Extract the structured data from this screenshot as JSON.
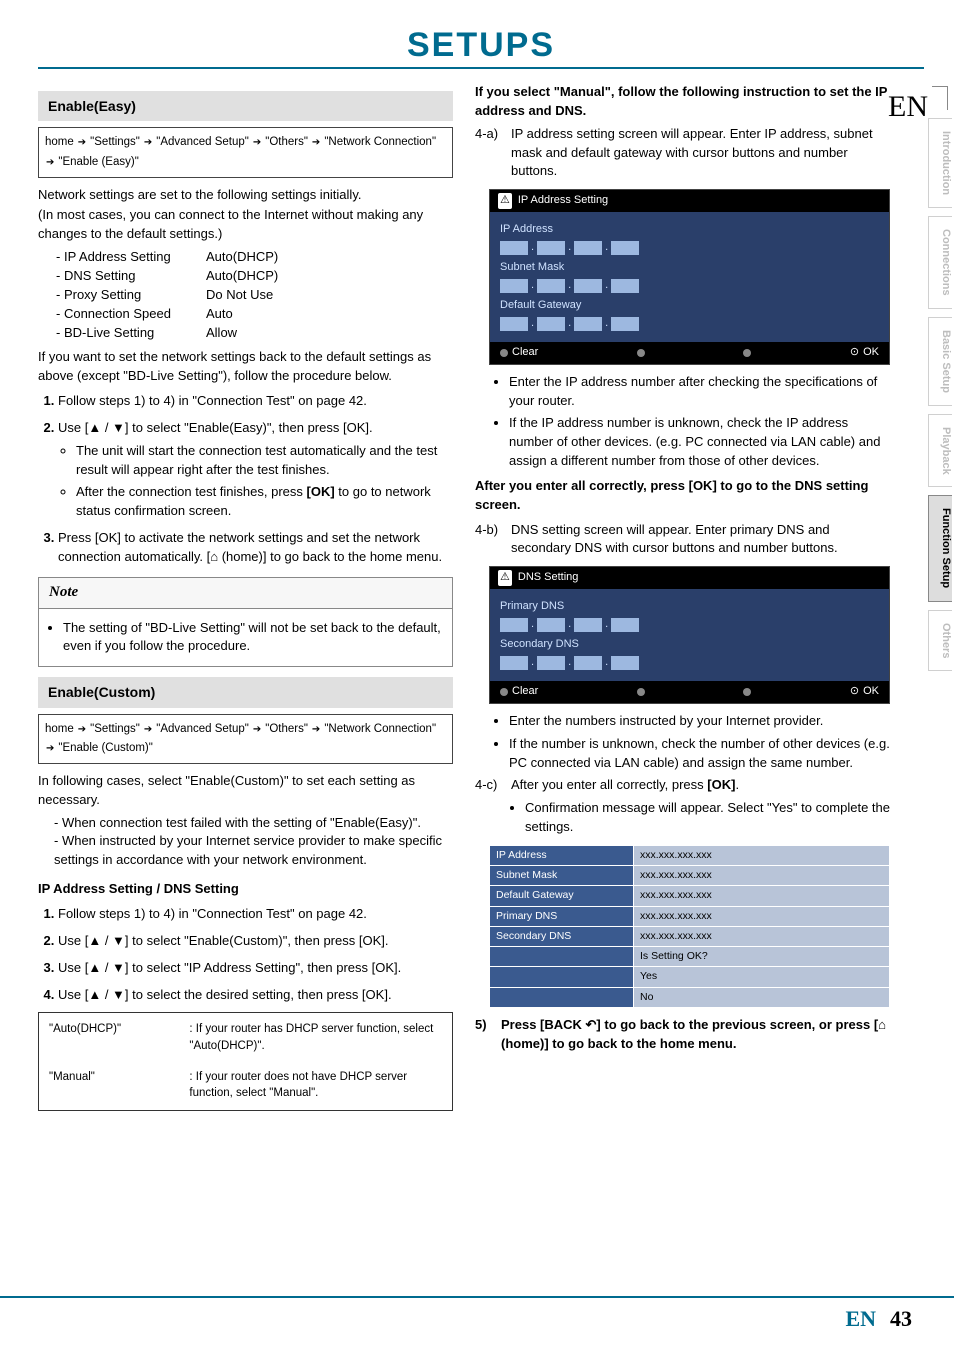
{
  "page_title": "SETUPS",
  "lang": "EN",
  "page_number": "43",
  "sidebar": {
    "tabs": [
      "Introduction",
      "Connections",
      "Basic Setup",
      "Playback",
      "Function Setup",
      "Others"
    ],
    "active": "Function Setup"
  },
  "left": {
    "enable_easy": {
      "heading": "Enable(Easy)",
      "crumb": [
        "home",
        "\"Settings\"",
        "\"Advanced Setup\"",
        "\"Others\"",
        "\"Network Connection\"",
        "\"Enable (Easy)\""
      ],
      "intro1": "Network settings are set to the following settings initially.",
      "intro2": "(In most cases, you can connect to the Internet without making any changes to the default settings.)",
      "defaults": [
        {
          "k": "IP Address Setting",
          "v": "Auto(DHCP)"
        },
        {
          "k": "DNS Setting",
          "v": "Auto(DHCP)"
        },
        {
          "k": "Proxy Setting",
          "v": "Do Not Use"
        },
        {
          "k": "Connection Speed",
          "v": "Auto"
        },
        {
          "k": "BD-Live Setting",
          "v": "Allow"
        }
      ],
      "reset_intro": "If you want to set the network settings back to the default settings as above (except \"BD-Live Setting\"), follow the procedure below.",
      "steps": [
        {
          "t": "Follow steps 1) to 4) in \"Connection Test\" on page 42."
        },
        {
          "t": "Use [▲ / ▼] to select \"Enable(Easy)\", then press [OK].",
          "bullets": [
            "The unit will start the connection test automatically and the test result will appear right after the test finishes.",
            "After the connection test finishes, press [OK] to go to network status confirmation screen."
          ]
        },
        {
          "t": "Press [OK] to activate the network settings and set the network connection automatically. [⌂ (home)] to go back to the home menu."
        }
      ],
      "note_head": "Note",
      "note_body": "The setting of \"BD-Live Setting\" will not be set back to the default, even if you follow the procedure."
    },
    "enable_custom": {
      "heading": "Enable(Custom)",
      "crumb": [
        "home",
        "\"Settings\"",
        "\"Advanced Setup\"",
        "\"Others\"",
        "\"Network Connection\"",
        "\"Enable (Custom)\""
      ],
      "intro": "In following cases, select \"Enable(Custom)\" to set each setting as necessary.",
      "cases": [
        "When connection test failed with the setting of \"Enable(Easy)\".",
        "When instructed by your Internet service provider to make specific settings in accordance with your network environment."
      ],
      "sub": "IP Address Setting / DNS Setting",
      "steps": [
        {
          "t": "Follow steps 1) to 4) in \"Connection Test\" on page 42."
        },
        {
          "t": "Use [▲ / ▼] to select \"Enable(Custom)\", then press [OK]."
        },
        {
          "t": "Use [▲ / ▼] to select \"IP Address Setting\", then press [OK]."
        },
        {
          "t": "Use [▲ / ▼] to select the desired setting, then press [OK]."
        }
      ],
      "options": [
        {
          "o": "\"Auto(DHCP)\"",
          "d": ": If your router has DHCP server function, select \"Auto(DHCP)\"."
        },
        {
          "o": "\"Manual\"",
          "d": ": If your router does not have DHCP server function, select \"Manual\"."
        }
      ]
    }
  },
  "right": {
    "manual_intro": "If you select \"Manual\", follow the following instruction to set the IP address and DNS.",
    "step4a": "IP address setting screen will appear. Enter IP address, subnet mask and default gateway with cursor buttons and number buttons.",
    "step4a_num": "4-a)",
    "ip_panel": {
      "title": "IP Address Setting",
      "rows": [
        "IP Address",
        "Subnet Mask",
        "Default Gateway"
      ],
      "footer_left": "Clear",
      "footer_right": "OK"
    },
    "ip_bullets": [
      "Enter the IP address number after checking the specifications of your router.",
      "If the IP address number is unknown, check the IP address number of other devices. (e.g. PC connected via LAN cable) and assign a different number from those of other devices."
    ],
    "after_ip": "After you enter all correctly, press [OK] to go to the DNS setting screen.",
    "step4b_num": "4-b)",
    "step4b": "DNS setting screen will appear. Enter primary DNS and secondary DNS with cursor buttons and number buttons.",
    "dns_panel": {
      "title": "DNS Setting",
      "rows": [
        "Primary DNS",
        "Secondary DNS"
      ],
      "footer_left": "Clear",
      "footer_right": "OK"
    },
    "dns_bullets": [
      "Enter the numbers instructed by your Internet provider.",
      "If the number is unknown, check the number of other devices (e.g. PC connected via LAN cable) and assign the same number."
    ],
    "step4c_num": "4-c)",
    "step4c": "After you enter all correctly, press [OK].",
    "step4c_bullets": [
      "Confirmation message will appear. Select \"Yes\" to complete the settings."
    ],
    "confirm_table": {
      "rows": [
        {
          "l": "IP Address",
          "r": "xxx.xxx.xxx.xxx"
        },
        {
          "l": "Subnet Mask",
          "r": "xxx.xxx.xxx.xxx"
        },
        {
          "l": "Default Gateway",
          "r": "xxx.xxx.xxx.xxx"
        },
        {
          "l": "Primary DNS",
          "r": "xxx.xxx.xxx.xxx"
        },
        {
          "l": "Secondary DNS",
          "r": "xxx.xxx.xxx.xxx"
        },
        {
          "l": "",
          "r": "Is Setting OK?"
        },
        {
          "l": "",
          "r": "Yes"
        },
        {
          "l": "",
          "r": "No"
        }
      ]
    },
    "step5": "Press [BACK ↶] to go back to the previous screen, or press [⌂ (home)] to go back to the home menu.",
    "step5_num": "5)"
  }
}
